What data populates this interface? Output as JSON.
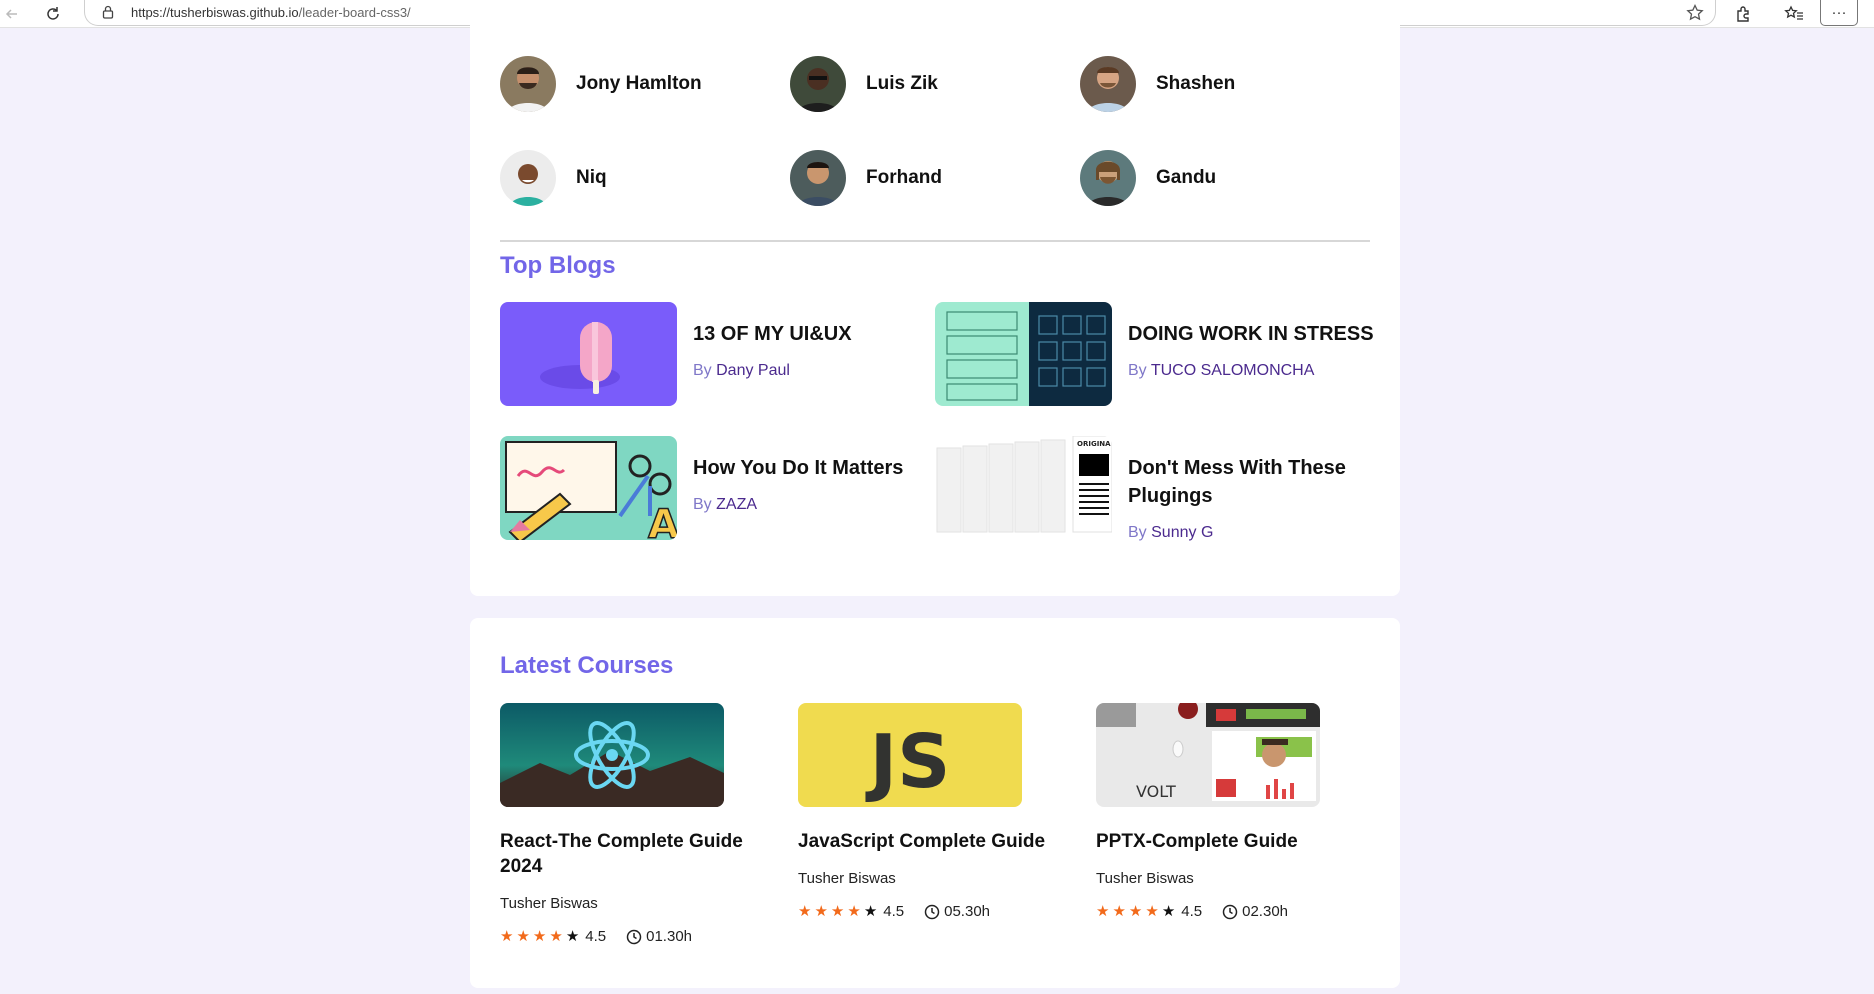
{
  "browser": {
    "url_main": "https://tusherbiswas.github.io",
    "url_path": "/leader-board-css3/",
    "more_label": "···"
  },
  "people": [
    {
      "name": "Jony Hamlton"
    },
    {
      "name": "Luis Zik"
    },
    {
      "name": "Shashen"
    },
    {
      "name": "Niq"
    },
    {
      "name": "Forhand"
    },
    {
      "name": "Gandu"
    }
  ],
  "top_blogs": {
    "title": "Top Blogs",
    "items": [
      {
        "title": "13 OF MY UI&UX",
        "by": "By",
        "author": "Dany Paul"
      },
      {
        "title": "DOING WORK IN STRESS",
        "by": "By",
        "author": "TUCO SALOMONCHA"
      },
      {
        "title": "How You Do It Matters",
        "by": "By",
        "author": "ZAZA"
      },
      {
        "title": "Don't Mess With These Plugings",
        "by": "By",
        "author": "Sunny G"
      }
    ]
  },
  "latest_courses": {
    "title": "Latest Courses",
    "items": [
      {
        "title": "React-The Complete Guide 2024",
        "author": "Tusher Biswas",
        "rating": "4.5",
        "stars": 4,
        "duration": "01.30h"
      },
      {
        "title": "JavaScript Complete Guide",
        "author": "Tusher Biswas",
        "rating": "4.5",
        "stars": 4,
        "duration": "05.30h"
      },
      {
        "title": "PPTX-Complete Guide",
        "author": "Tusher Biswas",
        "rating": "4.5",
        "stars": 4,
        "duration": "02.30h"
      }
    ],
    "js_logo_text": "JS",
    "volt_text": "VOLT",
    "original_text": "ORIGINA"
  },
  "colors": {
    "accent": "#7266e8",
    "author": "#4b2a8e",
    "star": "#f26a1b",
    "background": "#f3f1fc"
  }
}
